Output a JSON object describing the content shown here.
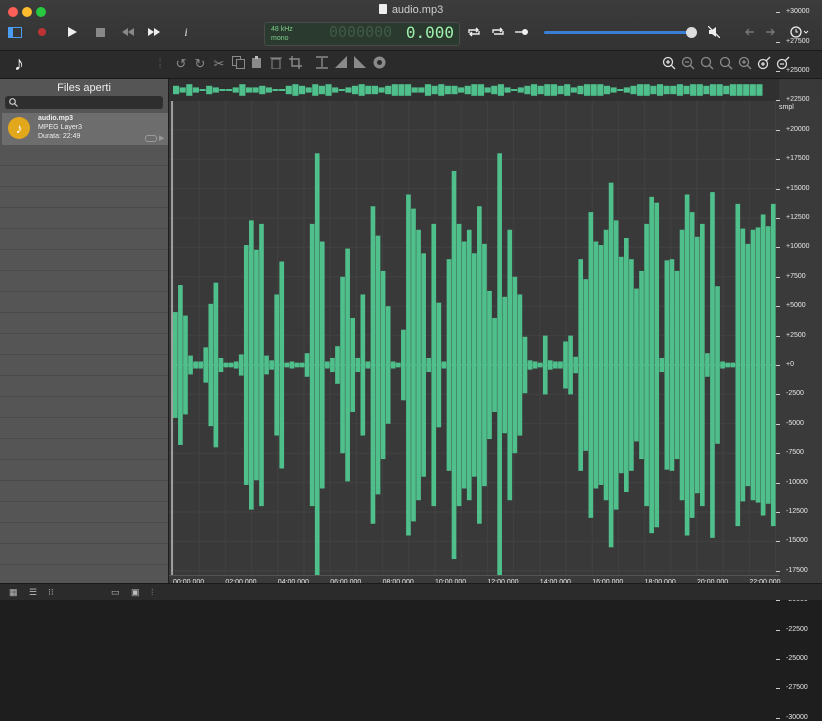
{
  "window": {
    "title": "audio.mp3"
  },
  "transport": {
    "info_label": "i"
  },
  "lcd": {
    "rate": "48 kHz",
    "channels": "mono",
    "dim_digits": "0000000",
    "time": "0.000"
  },
  "sidebar": {
    "title": "Files aperti",
    "search_placeholder": "",
    "files": [
      {
        "name": "audio.mp3",
        "format": "MPEG Layer3",
        "duration": "Durata: 22:49"
      }
    ]
  },
  "ruler": {
    "unit": "smpl",
    "labels": [
      "+30000",
      "+27500",
      "+25000",
      "+22500",
      "+20000",
      "+17500",
      "+15000",
      "+12500",
      "+10000",
      "+7500",
      "+5000",
      "+2500",
      "+0",
      "-2500",
      "-5000",
      "-7500",
      "-10000",
      "-12500",
      "-15000",
      "-17500",
      "-20000",
      "-22500",
      "-25000",
      "-27500",
      "-30000"
    ]
  },
  "timeline": {
    "labels": [
      "00:00.000",
      "02:00.000",
      "04:00.000",
      "06:00.000",
      "08:00.000",
      "10:00.000",
      "12:00.000",
      "14:00.000",
      "16:00.000",
      "18:00.000",
      "20:00.000",
      "22:00.000"
    ]
  },
  "waveform": {
    "color": "#4fbf8c",
    "peaks": [
      4500,
      6800,
      4200,
      800,
      300,
      300,
      1500,
      5200,
      7000,
      600,
      200,
      200,
      300,
      900,
      10200,
      12300,
      9800,
      12000,
      800,
      400,
      6000,
      8800,
      200,
      300,
      200,
      200,
      1000,
      12000,
      18000,
      10500,
      300,
      600,
      1600,
      7500,
      9900,
      4000,
      600,
      6000,
      300,
      13500,
      11000,
      8000,
      5000,
      300,
      200,
      3000,
      14500,
      13300,
      11500,
      9500,
      600,
      12000,
      5300,
      300,
      9000,
      16500,
      12000,
      10500,
      11500,
      9500,
      13500,
      10300,
      6300,
      4000,
      18000,
      5800,
      11500,
      7500,
      6000,
      2400,
      400,
      300,
      200,
      2500,
      400,
      300,
      300,
      2000,
      2500,
      700,
      9000,
      7300,
      13000,
      10500,
      10200,
      11500,
      15500,
      12300,
      9200,
      10800,
      9000,
      6500,
      8000,
      12000,
      14300,
      13800,
      600,
      8900,
      9000,
      8000,
      11500,
      14500,
      13000,
      10900,
      12000,
      1000,
      14700,
      6700,
      300,
      200,
      200,
      13700,
      11600,
      10300,
      11500,
      11700,
      12800,
      11800,
      13700
    ],
    "overview": [
      2,
      1,
      3,
      1,
      0,
      2,
      1,
      0,
      0,
      1,
      3,
      1,
      1,
      2,
      1,
      0,
      0,
      2,
      3,
      2,
      1,
      3,
      2,
      3,
      1,
      0,
      1,
      2,
      3,
      2,
      2,
      1,
      2,
      3,
      3,
      3,
      1,
      1,
      3,
      2,
      3,
      2,
      2,
      1,
      2,
      3,
      3,
      1,
      2,
      3,
      1,
      0,
      1,
      2,
      3,
      2,
      3,
      3,
      2,
      3,
      1,
      2,
      3,
      3,
      3,
      2,
      1,
      0,
      1,
      2,
      3,
      3,
      2,
      3,
      2,
      2,
      3,
      2,
      3,
      3,
      2,
      3,
      3,
      2,
      3,
      3,
      3,
      3,
      3
    ]
  },
  "bottombar": {}
}
